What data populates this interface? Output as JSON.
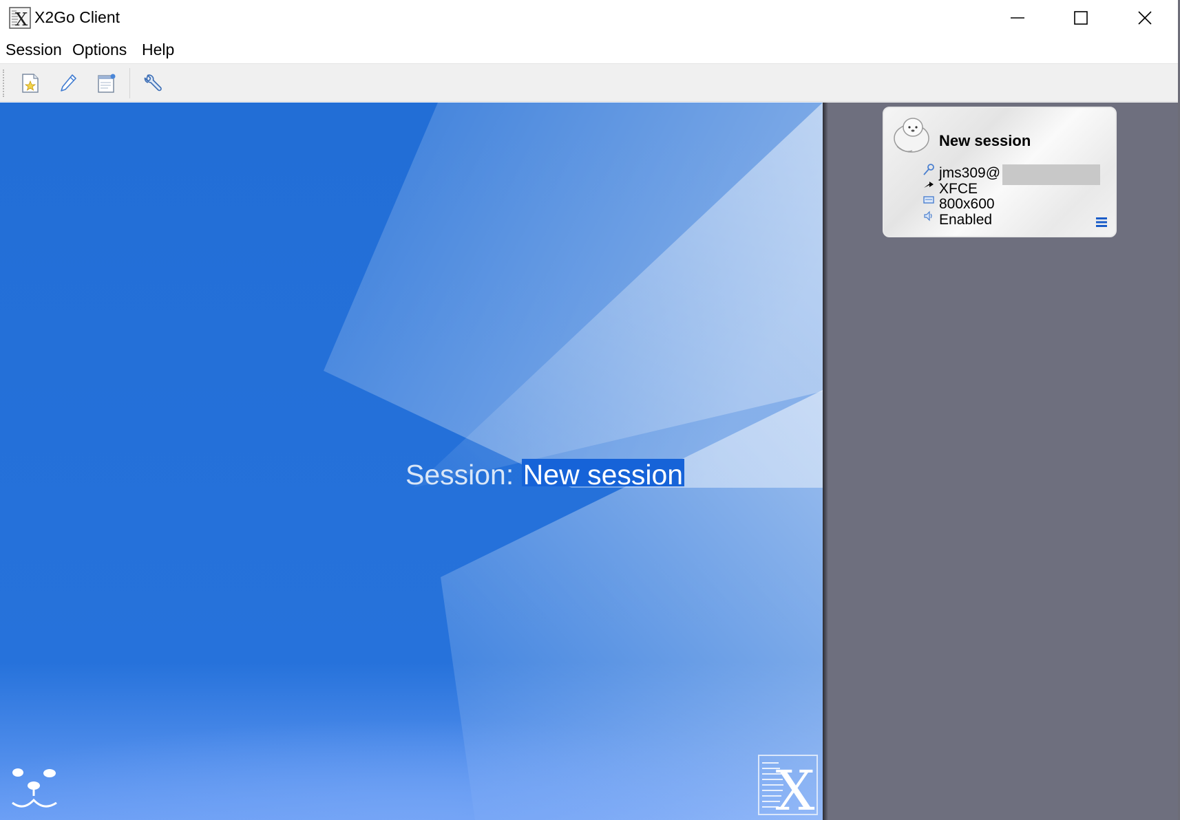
{
  "window": {
    "title": "X2Go Client",
    "controls": [
      "minimize",
      "maximize",
      "close"
    ]
  },
  "menubar": {
    "items": [
      {
        "label": "Session"
      },
      {
        "label": "Options"
      },
      {
        "label": "Help"
      }
    ]
  },
  "toolbar": {
    "buttons": [
      {
        "icon": "new-session-icon"
      },
      {
        "icon": "edit-session-icon"
      },
      {
        "icon": "session-properties-icon"
      },
      {
        "icon": "settings-wrench-icon"
      }
    ]
  },
  "main": {
    "session_prefix": "Session:",
    "session_value": "New session"
  },
  "session_card": {
    "title": "New session",
    "user": "jms309@",
    "user_host_redacted": true,
    "desktop": "XFCE",
    "resolution": "800x600",
    "sound": "Enabled"
  },
  "colors": {
    "main_blue": "#236fd6",
    "sidebar": "#6e6f7e",
    "selection": "#1663d8"
  }
}
